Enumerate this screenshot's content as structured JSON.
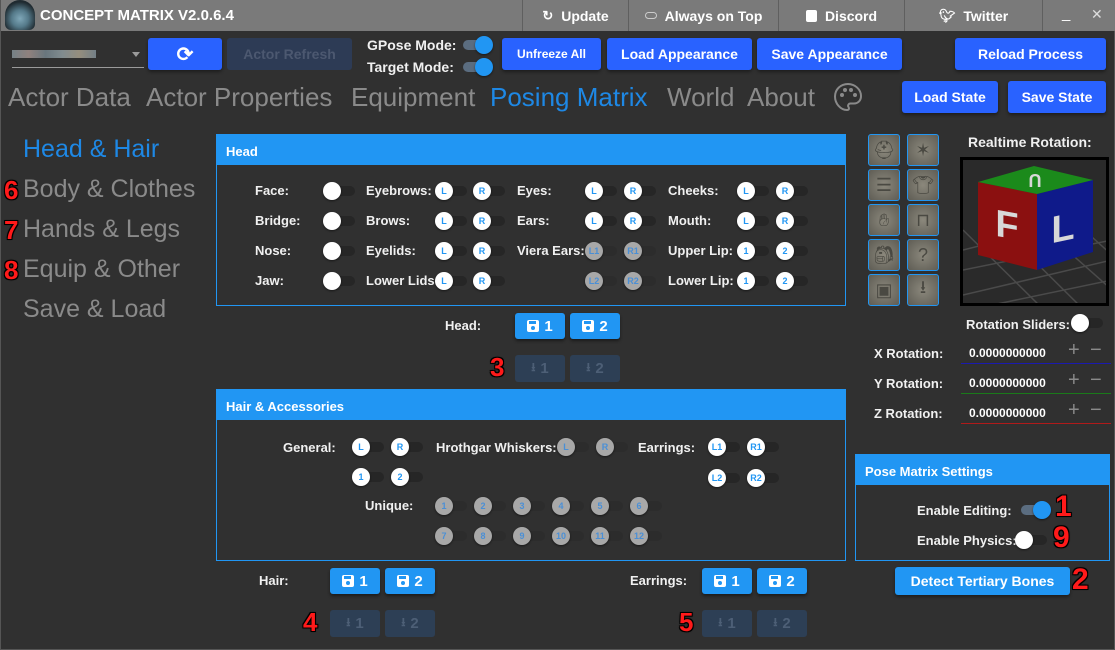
{
  "window": {
    "title": "CONCEPT MATRIX V2.0.6.4",
    "titlebar_items": [
      {
        "label": "Update",
        "icon": "update-icon"
      },
      {
        "label": "Always on Top",
        "icon": "toggle-icon"
      },
      {
        "label": "Discord",
        "icon": "discord-icon"
      },
      {
        "label": "Twitter",
        "icon": "twitter-icon"
      }
    ],
    "minimize": "_",
    "close": "✕"
  },
  "toolbar": {
    "actor_select_value": "(blurred actor name)",
    "refresh_icon": "⟳",
    "actor_refresh": "Actor Refresh",
    "gpose_mode_label": "GPose Mode:",
    "gpose_mode_on": true,
    "target_mode_label": "Target Mode:",
    "target_mode_on": true,
    "unfreeze_all": "Unfreeze All",
    "load_appearance": "Load Appearance",
    "save_appearance": "Save Appearance",
    "reload_process": "Reload Process",
    "load_state": "Load State",
    "save_state": "Save State"
  },
  "tabs": [
    {
      "label": "Actor Data",
      "active": false
    },
    {
      "label": "Actor Properties",
      "active": false
    },
    {
      "label": "Equipment",
      "active": false
    },
    {
      "label": "Posing Matrix",
      "active": true
    },
    {
      "label": "World",
      "active": false
    },
    {
      "label": "About",
      "active": false
    }
  ],
  "sidebar": [
    {
      "label": "Head & Hair",
      "active": true,
      "marker": ""
    },
    {
      "label": "Body & Clothes",
      "active": false,
      "marker": "6"
    },
    {
      "label": "Hands & Legs",
      "active": false,
      "marker": "7"
    },
    {
      "label": "Equip & Other",
      "active": false,
      "marker": "8"
    },
    {
      "label": "Save & Load",
      "active": false,
      "marker": ""
    }
  ],
  "head_panel": {
    "title": "Head",
    "rows": [
      {
        "label": "Face:"
      },
      {
        "label": "Bridge:"
      },
      {
        "label": "Nose:"
      },
      {
        "label": "Jaw:"
      },
      {
        "label": "Eyebrows:",
        "knobs": [
          "L",
          "R"
        ]
      },
      {
        "label": "Brows:",
        "knobs": [
          "L",
          "R"
        ]
      },
      {
        "label": "Eyelids:",
        "knobs": [
          "L",
          "R"
        ]
      },
      {
        "label": "Lower Lids:",
        "knobs": [
          "L",
          "R"
        ]
      },
      {
        "label": "Eyes:",
        "knobs": [
          "L",
          "R"
        ]
      },
      {
        "label": "Ears:",
        "knobs": [
          "L",
          "R"
        ]
      },
      {
        "label": "Viera Ears:",
        "knobs": [
          "L1",
          "R1"
        ]
      },
      {
        "label": "",
        "knobs": [
          "L2",
          "R2"
        ]
      },
      {
        "label": "Cheeks:",
        "knobs": [
          "L",
          "R"
        ]
      },
      {
        "label": "Mouth:",
        "knobs": [
          "L",
          "R"
        ]
      },
      {
        "label": "Upper Lip:",
        "knobs": [
          "1",
          "2"
        ]
      },
      {
        "label": "Lower Lip:",
        "knobs": [
          "1",
          "2"
        ]
      }
    ],
    "save_label": "Head:",
    "save_buttons": [
      "1",
      "2"
    ],
    "load_buttons": [
      "1",
      "2"
    ],
    "marker": "3"
  },
  "hair_panel": {
    "title": "Hair & Accessories",
    "general_label": "General:",
    "general_knobs": [
      "L",
      "R",
      "1",
      "2"
    ],
    "whiskers_label": "Hrothgar Whiskers:",
    "whiskers_knobs": [
      "L",
      "R"
    ],
    "earrings_label": "Earrings:",
    "earrings_knobs": [
      "L1",
      "R1",
      "L2",
      "R2"
    ],
    "unique_label": "Unique:",
    "unique_knobs": [
      "1",
      "2",
      "3",
      "4",
      "5",
      "6",
      "7",
      "8",
      "9",
      "10",
      "11",
      "12"
    ],
    "hair_save_label": "Hair:",
    "earrings_save_label": "Earrings:",
    "save_buttons": [
      "1",
      "2"
    ],
    "load_buttons": [
      "1",
      "2"
    ],
    "hair_marker": "4",
    "earrings_marker": "5"
  },
  "icon_grid": [
    "helmet-icon",
    "hair-icon",
    "body-armor-icon",
    "clothes-icon",
    "hand-icon",
    "legs-icon",
    "bag-icon",
    "mystery-box-icon",
    "save-disk-icon",
    "download-icon"
  ],
  "rotation": {
    "title": "Realtime Rotation:",
    "cube_faces": {
      "front": "F",
      "left": "L",
      "top": "U"
    },
    "sliders_label": "Rotation Sliders:",
    "sliders_on": false,
    "x_label": "X Rotation:",
    "x_value": "0.0000000000",
    "y_label": "Y Rotation:",
    "y_value": "0.0000000000",
    "z_label": "Z Rotation:",
    "z_value": "0.0000000000",
    "plus": "+",
    "minus": "−",
    "axis_colors": {
      "x": "#1a1ab0",
      "y": "#1a7a1a",
      "z": "#b01a1a"
    }
  },
  "settings": {
    "title": "Pose Matrix Settings",
    "enable_editing_label": "Enable Editing:",
    "enable_editing_on": true,
    "editing_marker": "1",
    "enable_physics_label": "Enable Physics:",
    "enable_physics_on": false,
    "physics_marker": "9",
    "detect_tertiary": "Detect Tertiary Bones",
    "detect_marker": "2"
  },
  "colors": {
    "accent": "#2196f3",
    "primary_button": "#2962ff",
    "background": "#303030",
    "titlebar": "#7a7a7a",
    "marker": "#ff1a1a"
  }
}
